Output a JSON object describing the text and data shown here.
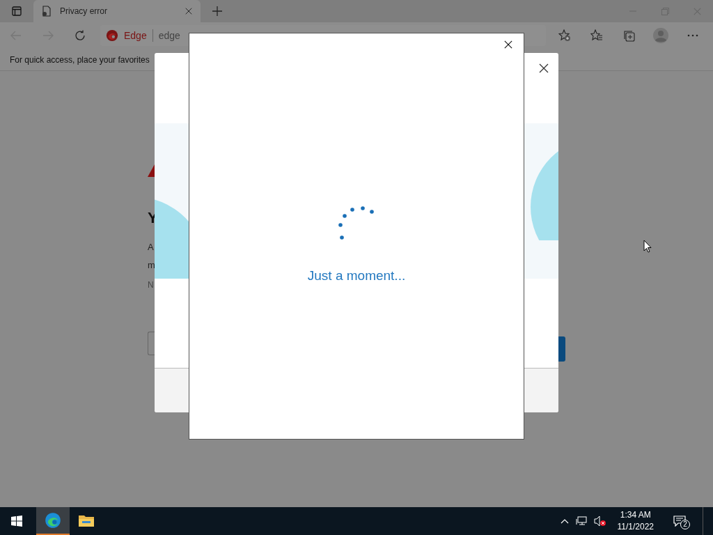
{
  "browser": {
    "tab": {
      "title": "Privacy error"
    },
    "address": {
      "site_label": "Edge",
      "url": "edge"
    },
    "favorites_bar": {
      "message": "For quick access, place your favorites"
    }
  },
  "background_page": {
    "heading": "Y",
    "paragraph_lines": [
      "A",
      "m"
    ],
    "note": "N"
  },
  "dialog": {
    "message": "Just a moment..."
  },
  "taskbar": {
    "apps": [
      {
        "kind": "edge",
        "selected": true
      },
      {
        "kind": "explorer",
        "selected": false
      }
    ],
    "volume_muted": true,
    "time": "1:34 AM",
    "date": "11/1/2022",
    "notification_count": "2"
  }
}
